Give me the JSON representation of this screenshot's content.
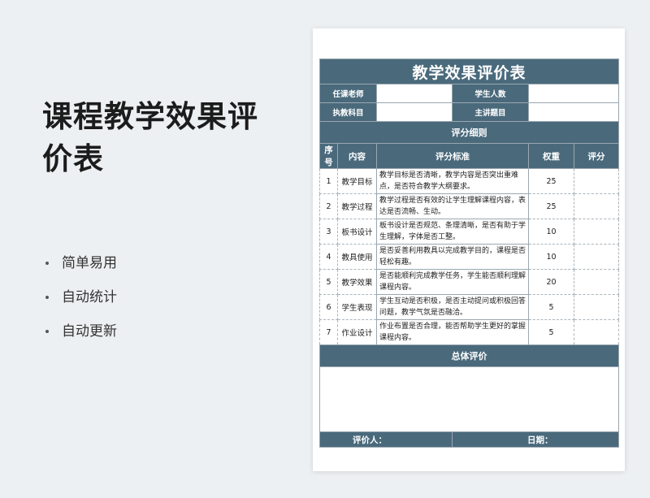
{
  "promo": {
    "title": "课程教学效果评价表",
    "features": [
      "简单易用",
      "自动统计",
      "自动更新"
    ]
  },
  "sheet": {
    "title": "教学效果评价表",
    "info": {
      "teacher_label": "任课老师",
      "students_label": "学生人数",
      "subject_label": "执教科目",
      "topic_label": "主讲题目"
    },
    "detail_title": "评分细则",
    "headers": [
      "序号",
      "内容",
      "评分标准",
      "权重",
      "评分"
    ],
    "rows": [
      {
        "no": "1",
        "item": "教学目标",
        "criteria": "教学目标是否清晰，教学内容是否突出重难点，是否符合教学大纲要求。",
        "weight": "25"
      },
      {
        "no": "2",
        "item": "教学过程",
        "criteria": "教学过程是否有效的让学生理解课程内容，表达是否流畅、生动。",
        "weight": "25"
      },
      {
        "no": "3",
        "item": "板书设计",
        "criteria": "板书设计是否规范、条理清晰，是否有助于学生理解，字体是否工整。",
        "weight": "10"
      },
      {
        "no": "4",
        "item": "教具使用",
        "criteria": "是否妥善利用教具以完成教学目的，课程是否轻松有趣。",
        "weight": "10"
      },
      {
        "no": "5",
        "item": "教学效果",
        "criteria": "是否能顺利完成教学任务，学生能否顺利理解课程内容。",
        "weight": "20"
      },
      {
        "no": "6",
        "item": "学生表现",
        "criteria": "学生互动是否积极，是否主动提问或积极回答问题，教学气氛是否融洽。",
        "weight": "5"
      },
      {
        "no": "7",
        "item": "作业设计",
        "criteria": "作业布置是否合理，能否帮助学生更好的掌握课程内容。",
        "weight": "5"
      }
    ],
    "overall_title": "总体评价",
    "footer": {
      "evaluator_label": "评价人：",
      "date_label": "日期："
    }
  },
  "colors": {
    "header_fill": "#4a6a7c",
    "background": "#edf0f2"
  }
}
